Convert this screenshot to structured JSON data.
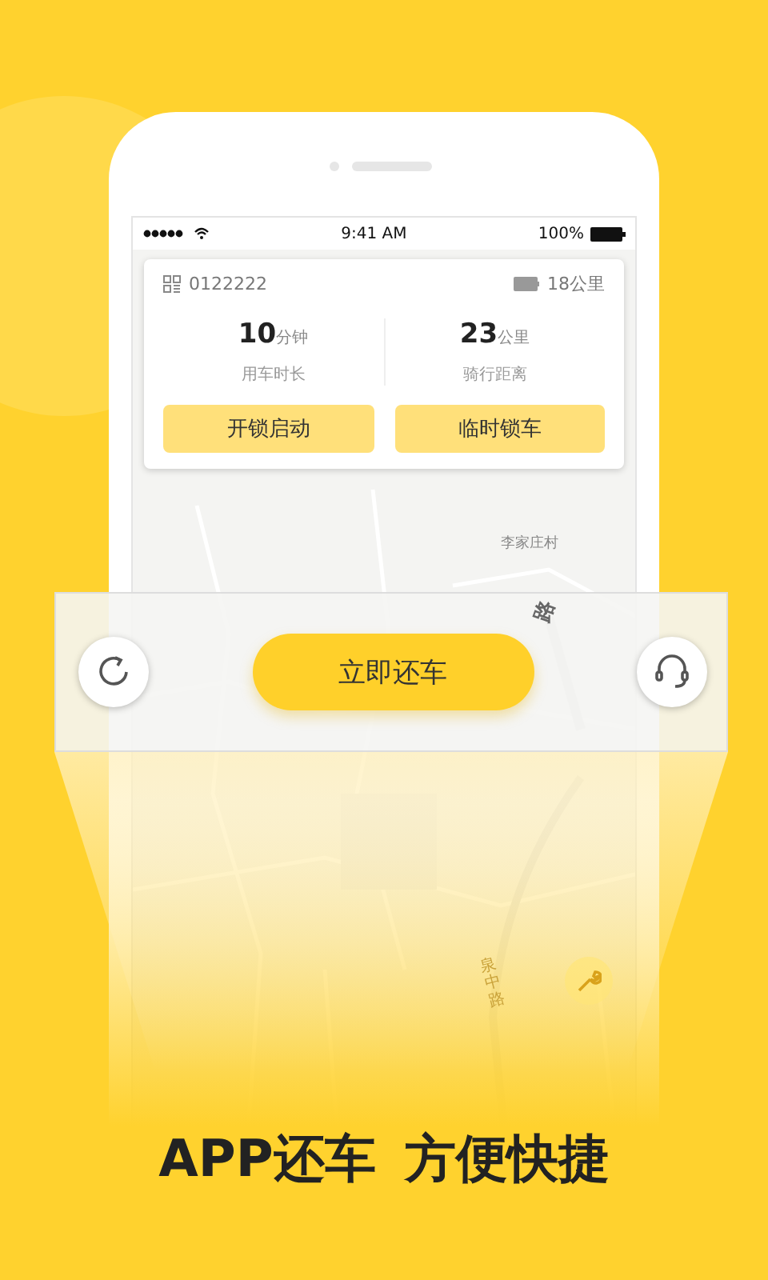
{
  "status_bar": {
    "time": "9:41 AM",
    "battery": "100%"
  },
  "bike_card": {
    "bike_id": "0122222",
    "range": "18公里",
    "stats": [
      {
        "value": "10",
        "unit": "分钟",
        "label": "用车时长"
      },
      {
        "value": "23",
        "unit": "公里",
        "label": "骑行距离"
      }
    ],
    "buttons": [
      "开锁启动",
      "临时锁车"
    ]
  },
  "map": {
    "labels": [
      {
        "text": "李家庄村",
        "kind": "place"
      },
      {
        "text": "路",
        "kind": "road"
      },
      {
        "text": "泉中路",
        "kind": "vertical"
      }
    ]
  },
  "action_bar": {
    "return_button": "立即还车"
  },
  "slogan": [
    "APP还车",
    "方便快捷"
  ]
}
